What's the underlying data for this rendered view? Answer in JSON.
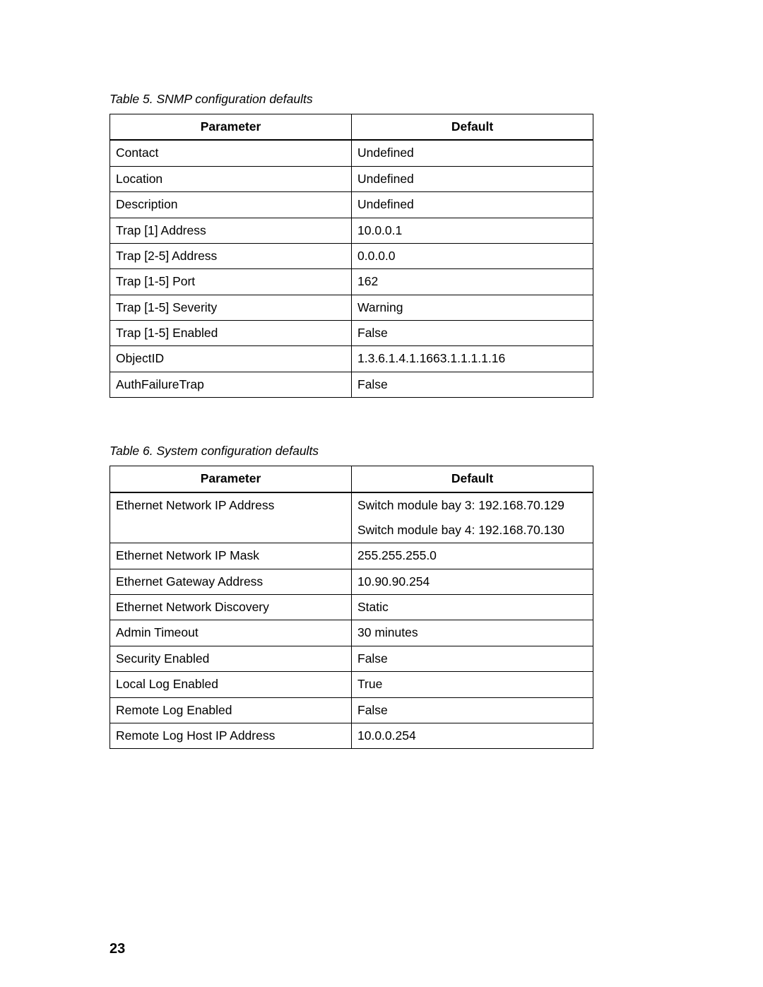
{
  "page_number": "23",
  "table5": {
    "caption": "Table 5. SNMP configuration defaults",
    "header_parameter": "Parameter",
    "header_default": "Default",
    "rows": [
      {
        "parameter": "Contact",
        "default": "Undefined"
      },
      {
        "parameter": "Location",
        "default": "Undefined"
      },
      {
        "parameter": "Description",
        "default": "Undefined"
      },
      {
        "parameter": "Trap [1] Address",
        "default": "10.0.0.1"
      },
      {
        "parameter": "Trap [2-5] Address",
        "default": "0.0.0.0"
      },
      {
        "parameter": "Trap [1-5] Port",
        "default": "162"
      },
      {
        "parameter": "Trap [1-5] Severity",
        "default": "Warning"
      },
      {
        "parameter": "Trap [1-5] Enabled",
        "default": "False"
      },
      {
        "parameter": "ObjectID",
        "default": "1.3.6.1.4.1.1663.1.1.1.1.16"
      },
      {
        "parameter": "AuthFailureTrap",
        "default": "False"
      }
    ]
  },
  "table6": {
    "caption": "Table 6. System configuration defaults",
    "header_parameter": "Parameter",
    "header_default": "Default",
    "rows": [
      {
        "parameter": "Ethernet Network IP Address",
        "default": "Switch module bay 3: 192.168.70.129",
        "default_extra": "Switch module bay 4: 192.168.70.130"
      },
      {
        "parameter": "Ethernet Network IP Mask",
        "default": "255.255.255.0"
      },
      {
        "parameter": "Ethernet Gateway Address",
        "default": "10.90.90.254"
      },
      {
        "parameter": "Ethernet Network Discovery",
        "default": "Static"
      },
      {
        "parameter": "Admin Timeout",
        "default": "30 minutes"
      },
      {
        "parameter": "Security Enabled",
        "default": "False"
      },
      {
        "parameter": "Local Log Enabled",
        "default": "True"
      },
      {
        "parameter": "Remote Log Enabled",
        "default": "False"
      },
      {
        "parameter": "Remote Log Host IP Address",
        "default": "10.0.0.254"
      }
    ]
  }
}
